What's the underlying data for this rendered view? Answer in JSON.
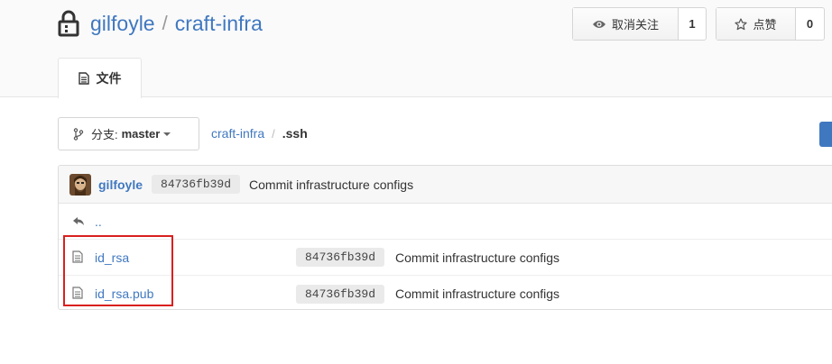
{
  "repo": {
    "owner": "gilfoyle",
    "separator": "/",
    "name": "craft-infra"
  },
  "actions": {
    "watch": {
      "label": "取消关注",
      "count": "1"
    },
    "star": {
      "label": "点赞",
      "count": "0"
    }
  },
  "tabs": [
    {
      "label": "文件"
    }
  ],
  "branch": {
    "prefix": "分支:",
    "name": "master"
  },
  "breadcrumb": {
    "root": "craft-infra",
    "separator": "/",
    "current": ".ssh"
  },
  "latest_commit": {
    "author": "gilfoyle",
    "sha": "84736fb39d",
    "message": "Commit infrastructure configs"
  },
  "files": {
    "parent_link": "..",
    "rows": [
      {
        "name": "id_rsa",
        "sha": "84736fb39d",
        "message": "Commit infrastructure configs"
      },
      {
        "name": "id_rsa.pub",
        "sha": "84736fb39d",
        "message": "Commit infrastructure configs"
      }
    ]
  },
  "colors": {
    "link": "#4078c0",
    "highlight": "#d9201f"
  }
}
